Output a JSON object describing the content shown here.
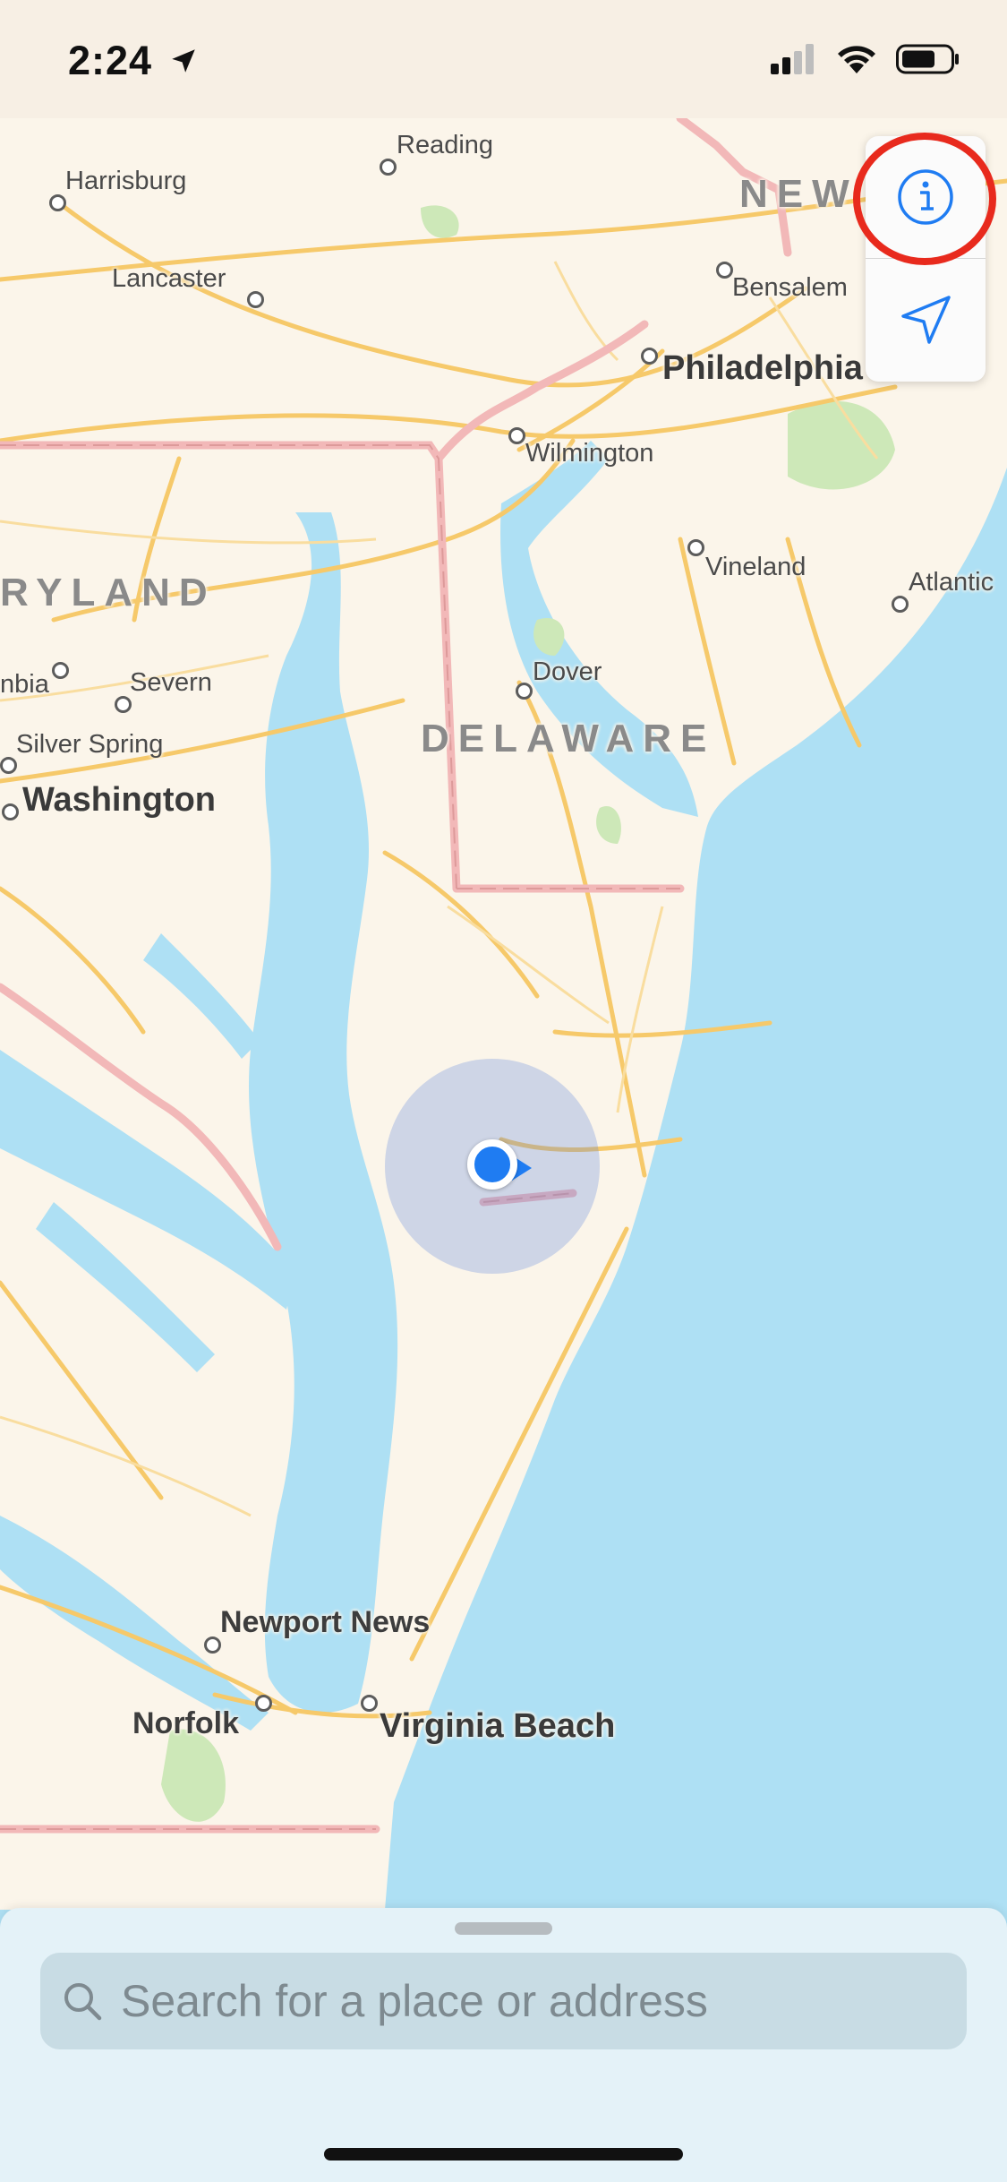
{
  "status_bar": {
    "time": "2:24",
    "location_services_icon": "location-arrow-icon",
    "signal_icon": "cellular-signal-icon",
    "wifi_icon": "wifi-icon",
    "battery_icon": "battery-icon"
  },
  "map": {
    "labels": {
      "reading": "Reading",
      "harrisburg": "Harrisburg",
      "lancaster": "Lancaster",
      "new_jersey": "NEW",
      "bensalem": "Bensalem",
      "philadelphia": "Philadelphia",
      "wilmington": "Wilmington",
      "vineland": "Vineland",
      "atlantic": "Atlantic",
      "maryland": "RYLAND",
      "columbia": "nbia",
      "severn": "Severn",
      "silver_spring": "Silver Spring",
      "washington": "Washington",
      "dover": "Dover",
      "delaware": "DELAWARE",
      "newport_news": "Newport News",
      "norfolk": "Norfolk",
      "virginia_beach": "Virginia Beach"
    },
    "colors": {
      "water": "#aee0f4",
      "land": "#fbf5ea",
      "roads": "#f6c96a",
      "state_border": "#f2b8b8",
      "park": "#cde8b8",
      "user_location": "#1f7cf2",
      "highlight_ring": "#e82a1d"
    }
  },
  "controls": {
    "info_button_icon": "info-icon",
    "locate_button_icon": "location-arrow-icon"
  },
  "search": {
    "placeholder": "Search for a place or address",
    "icon": "magnifier-icon"
  }
}
